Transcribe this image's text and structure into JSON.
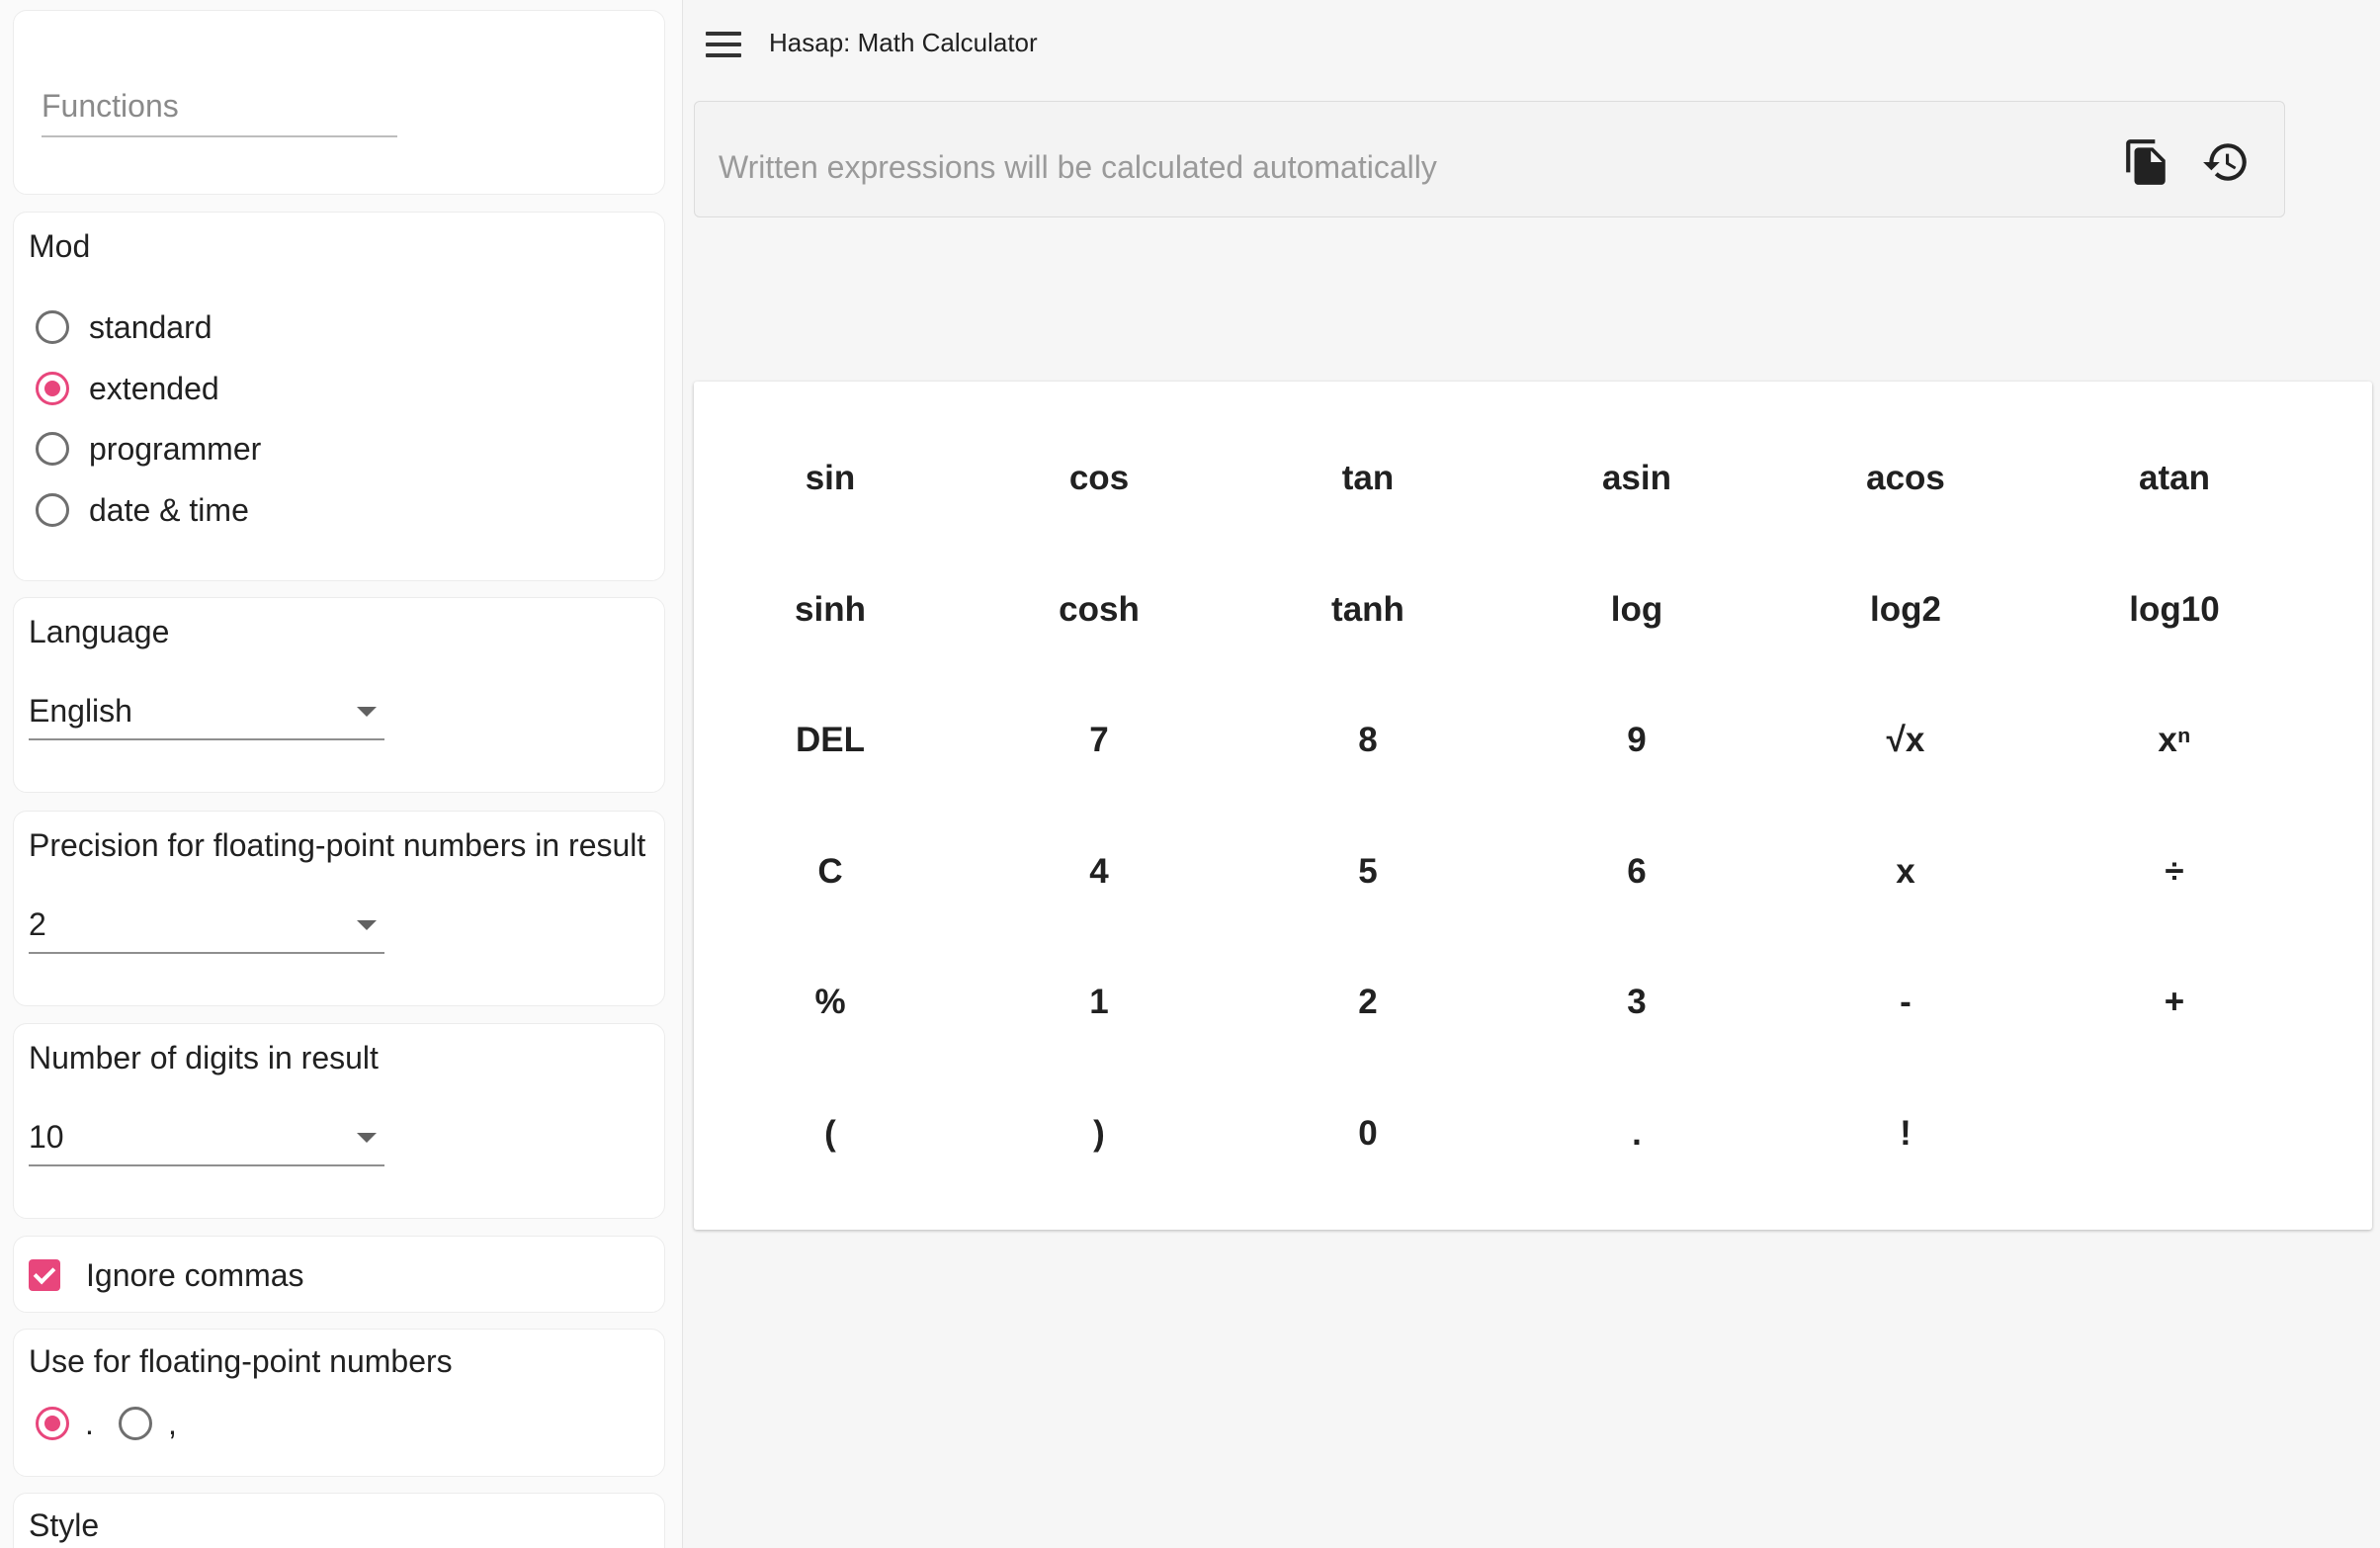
{
  "app": {
    "title": "Hasap: Math Calculator"
  },
  "sidebar": {
    "functions": {
      "placeholder": "Functions"
    },
    "mod": {
      "title": "Mod",
      "options": [
        {
          "label": "standard",
          "selected": false
        },
        {
          "label": "extended",
          "selected": true
        },
        {
          "label": "programmer",
          "selected": false
        },
        {
          "label": "date & time",
          "selected": false
        }
      ]
    },
    "language": {
      "title": "Language",
      "value": "English"
    },
    "precision": {
      "title": "Precision for floating-point numbers in result",
      "value": "2"
    },
    "digits": {
      "title": "Number of digits in result",
      "value": "10"
    },
    "ignore_commas": {
      "label": "Ignore commas",
      "checked": true
    },
    "separator": {
      "title": "Use for floating-point numbers",
      "options": [
        {
          "label": ".",
          "selected": true
        },
        {
          "label": ",",
          "selected": false
        }
      ]
    },
    "style": {
      "title": "Style"
    }
  },
  "expression": {
    "placeholder": "Written expressions will be calculated automatically",
    "copy_icon": "copy-icon",
    "history_icon": "history-icon"
  },
  "keypad": {
    "rows": [
      [
        "sin",
        "cos",
        "tan",
        "asin",
        "acos",
        "atan"
      ],
      [
        "sinh",
        "cosh",
        "tanh",
        "log",
        "log2",
        "log10"
      ],
      [
        "DEL",
        "7",
        "8",
        "9",
        "√x",
        "xⁿ"
      ],
      [
        "C",
        "4",
        "5",
        "6",
        "x",
        "÷"
      ],
      [
        "%",
        "1",
        "2",
        "3",
        "-",
        "+"
      ],
      [
        "(",
        ")",
        "0",
        ".",
        "!",
        ""
      ]
    ]
  },
  "colors": {
    "accent": "#e8467c",
    "background": "#f6f6f6"
  }
}
